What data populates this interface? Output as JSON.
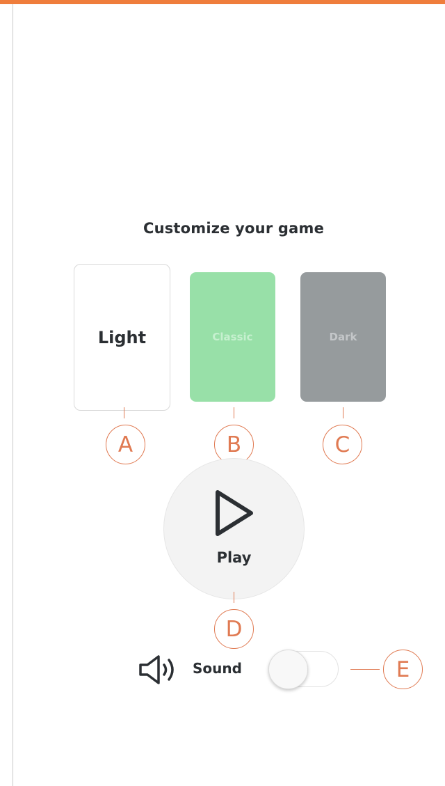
{
  "title": "Customize your game",
  "themes": [
    {
      "label": "Light",
      "background": "#ffffff"
    },
    {
      "label": "Classic",
      "background": "#98e0a8"
    },
    {
      "label": "Dark",
      "background": "#969b9d"
    }
  ],
  "play": {
    "label": "Play",
    "icon": "play-triangle-icon"
  },
  "sound": {
    "label": "Sound",
    "icon": "speaker-icon",
    "enabled": false
  },
  "callouts": {
    "a": "A",
    "b": "B",
    "c": "C",
    "d": "D",
    "e": "E"
  },
  "colors": {
    "accent": "#ef7d3c",
    "callout": "#e07a52",
    "text": "#2b2f33"
  }
}
